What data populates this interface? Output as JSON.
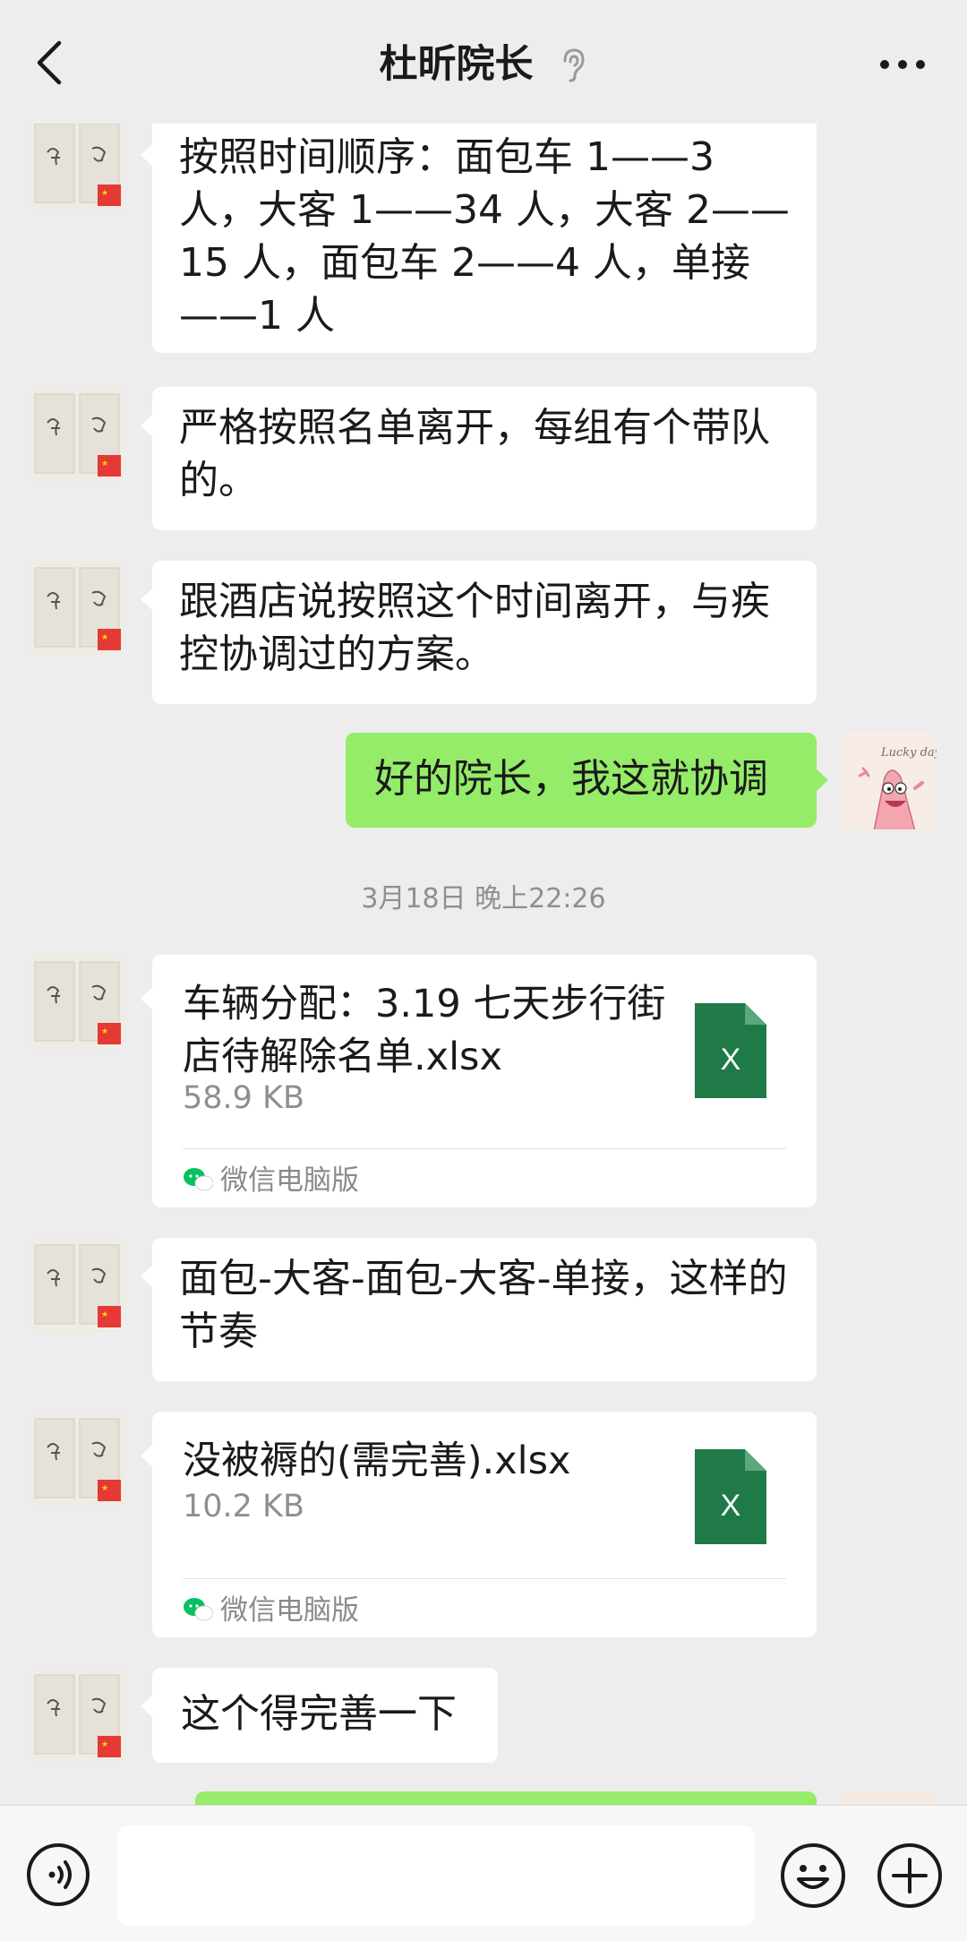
{
  "header": {
    "title": "杜昕院长",
    "back_icon": "chevron-left-icon",
    "status_icon": "ear-icon",
    "more_icon": "more-dots-icon"
  },
  "messages": {
    "m1": "按照时间顺序：面包车 1——3 人，大客 1——34 人，大客 2——15 人，面包车 2——4 人，单接——1 人",
    "m2": "严格按照名单离开，每组有个带队的。",
    "m3": "跟酒店说按照这个时间离开，与疾控协调过的方案。",
    "m4": "好的院长，我这就协调",
    "timestamp": "3月18日 晚上22:26",
    "file1": {
      "name": "车辆分配：3.19 七天步行街店待解除名单.xlsx",
      "size": "58.9 KB",
      "source": "微信电脑版"
    },
    "m5": "面包-大客-面包-大客-单接，这样的节奏",
    "file2": {
      "name": "没被褥的(需完善).xlsx",
      "size": "10.2 KB",
      "source": "微信电脑版"
    },
    "m6": "这个得完善一下",
    "file_icon_label": "X",
    "sticker_text": "Lucky day"
  },
  "input_bar": {
    "voice_icon": "voice-icon",
    "emoji_icon": "emoji-icon",
    "plus_icon": "plus-icon",
    "placeholder": ""
  },
  "colors": {
    "background": "#ededed",
    "sent_bubble": "#95ec69",
    "received_bubble": "#ffffff",
    "excel_green": "#1f7a47"
  }
}
